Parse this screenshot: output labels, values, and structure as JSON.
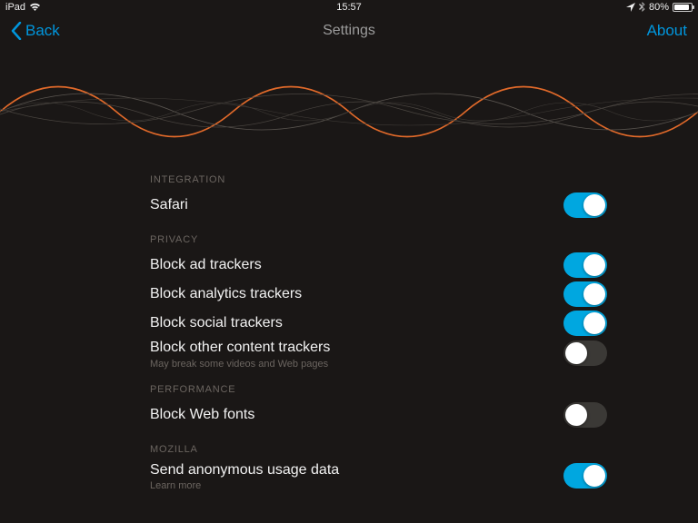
{
  "status": {
    "device": "iPad",
    "time": "15:57",
    "battery_pct": "80%"
  },
  "nav": {
    "back": "Back",
    "title": "Settings",
    "about": "About"
  },
  "sections": {
    "integration": {
      "header": "INTEGRATION",
      "safari": "Safari",
      "safari_on": true
    },
    "privacy": {
      "header": "PRIVACY",
      "block_ad": "Block ad trackers",
      "block_ad_on": true,
      "block_analytics": "Block analytics trackers",
      "block_analytics_on": true,
      "block_social": "Block social trackers",
      "block_social_on": true,
      "block_other": "Block other content trackers",
      "block_other_sub": "May break some videos and Web pages",
      "block_other_on": false
    },
    "performance": {
      "header": "PERFORMANCE",
      "block_fonts": "Block Web fonts",
      "block_fonts_on": false
    },
    "mozilla": {
      "header": "MOZILLA",
      "send_data": "Send anonymous usage data",
      "send_data_sub": "Learn more",
      "send_data_on": true
    }
  },
  "colors": {
    "accent": "#00a7e0",
    "link": "#0096dd",
    "wave": "#e26a2a"
  }
}
